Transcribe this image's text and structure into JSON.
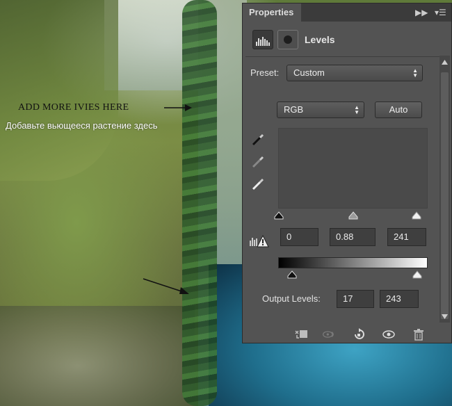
{
  "annotation": {
    "english": "ADD MORE IVIES HERE",
    "russian": "Добавьте вьющееся растение здесь"
  },
  "panel": {
    "tab_label": "Properties",
    "title": "Levels",
    "preset_label": "Preset:",
    "preset_value": "Custom",
    "channel_value": "RGB",
    "auto_label": "Auto",
    "input_levels": {
      "black": "0",
      "gamma": "0.88",
      "white": "241"
    },
    "output_label": "Output Levels:",
    "output_levels": {
      "low": "17",
      "high": "243"
    }
  },
  "colors": {
    "panel_bg": "#535353",
    "tab_bar": "#3b3b3b",
    "field_bg": "#3f3f3f",
    "text": "#e3e3e3"
  },
  "icons": [
    "expand-icon",
    "panel-menu-icon",
    "levels-adjustment-icon",
    "mask-icon",
    "black-eyedropper-icon",
    "gray-eyedropper-icon",
    "white-eyedropper-icon",
    "calculate-levels-icon",
    "clip-to-layer-icon",
    "view-previous-icon",
    "reset-icon",
    "visibility-eye-icon",
    "delete-trash-icon"
  ]
}
